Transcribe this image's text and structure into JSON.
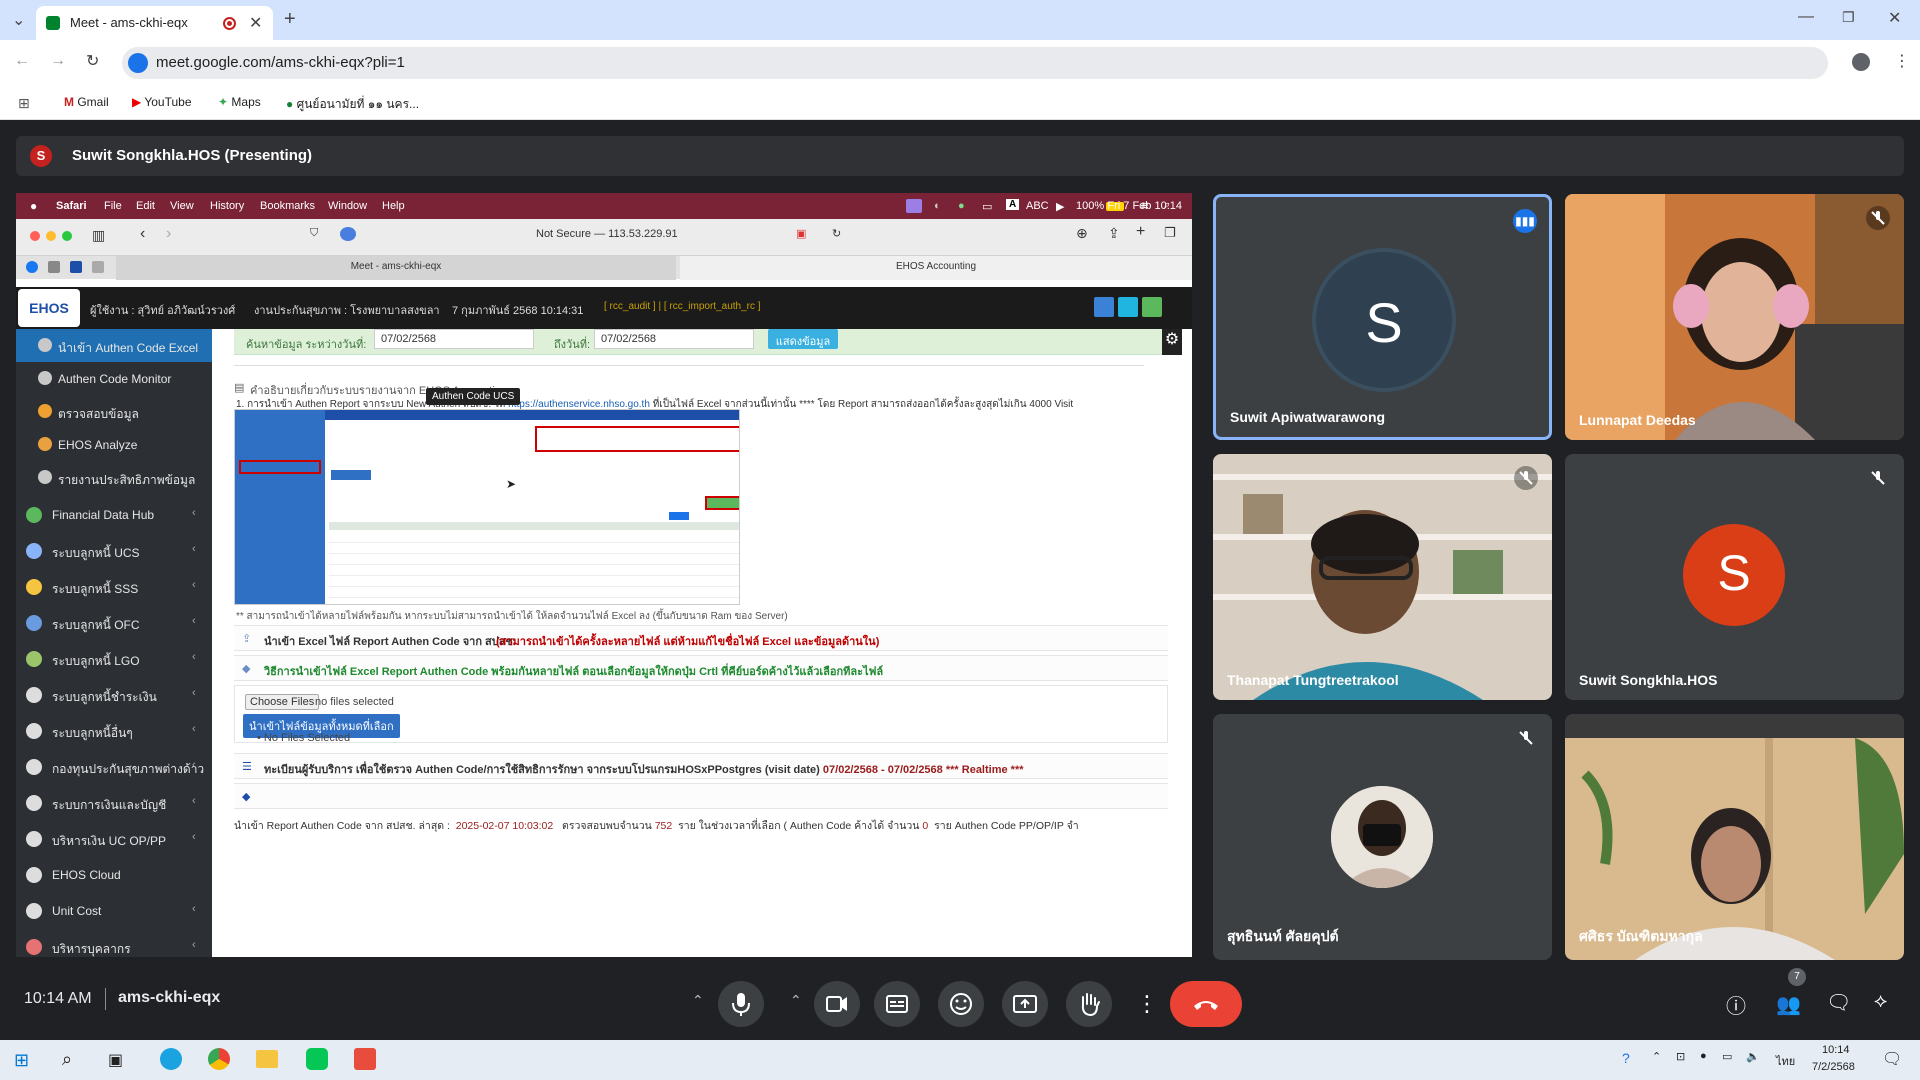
{
  "browser": {
    "tab_title": "Meet - ams-ckhi-eqx",
    "url": "meet.google.com/ams-ckhi-eqx?pli=1",
    "bookmarks": [
      "Gmail",
      "YouTube",
      "Maps",
      "ศูนย์อนามัยที่ ๑๑ นคร..."
    ]
  },
  "meet": {
    "presenter_initial": "S",
    "presenter_label": "Suwit Songkhla.HOS (Presenting)",
    "time": "10:14 AM",
    "meeting_code": "ams-ckhi-eqx",
    "participants_count": "7"
  },
  "tiles": [
    {
      "name": "Suwit Apiwatwarawong",
      "initial": "S"
    },
    {
      "name": "Lunnapat Deedas"
    },
    {
      "name": "Thanapat Tungtreetrakool"
    },
    {
      "name": "Suwit Songkhla.HOS",
      "initial": "S"
    },
    {
      "name": "สุทธินนท์ ศัลยคุปต์"
    },
    {
      "name": "ศศิธร บัณฑิตมหากุล"
    }
  ],
  "mac": {
    "menus": [
      "Safari",
      "File",
      "Edit",
      "View",
      "History",
      "Bookmarks",
      "Window",
      "Help"
    ],
    "battery": "100%",
    "datetime": "Fri 7 Feb 10:14",
    "abc": "ABC"
  },
  "safari": {
    "address": "Not Secure — 113.53.229.91",
    "tab1": "Meet - ams-ckhi-eqx",
    "tab2": "EHOS Accounting"
  },
  "ehos": {
    "logo": "EHOS",
    "header_user": "ผู้ใช้งาน : สุวิทย์ อภิวัฒน์วรวงศ์",
    "header_org": "งานประกันสุขภาพ : โรงพยาบาลสงขลา",
    "header_date": "7 กุมภาพันธ์ 2568 10:14:31",
    "header_tags": "[ rcc_audit ] | [ rcc_import_auth_rc ]",
    "date_from_label": "ค้นหาข้อมูล ระหว่างวันที่:",
    "date_from": "07/02/2568",
    "date_to_label": "ถึงวันที่:",
    "date_to": "07/02/2568",
    "show_btn": "แสดงข้อมูล",
    "sidebar_sub": [
      "นำเข้า Authen Code Excel",
      "Authen Code Monitor",
      "ตรวจสอบข้อมูล",
      "EHOS Analyze",
      "รายงานประสิทธิภาพข้อมูล"
    ],
    "sidebar_main": [
      "Financial Data Hub",
      "ระบบลูกหนี้ UCS",
      "ระบบลูกหนี้ SSS",
      "ระบบลูกหนี้ OFC",
      "ระบบลูกหนี้ LGO",
      "ระบบลูกหนี้ชำระเงิน",
      "ระบบลูกหนี้อื่นๆ",
      "กองทุนประกันสุขภาพต่างด้าว",
      "ระบบการเงินและบัญชี",
      "บริหารเงิน UC OP/PP",
      "EHOS Cloud",
      "Unit Cost",
      "บริหารบุคลากร"
    ],
    "desc_title": "คำอธิบายเกี่ยวกับระบบรายงานจาก EHOS Accounting",
    "tooltip": "Authen Code UCS",
    "step1": "1. การนำเข้า Authen Report จากระบบ New Authen สปสช. ให้",
    "step1_link": "https://authenservice.nhso.go.th",
    "step1_tail": "ที่เป็นไฟล์ Excel จากส่วนนี้เท่านั้น **** โดย Report สามารถส่งออกได้ครั้งละสูงสุดไม่เกิน 4000 Visit",
    "note": "** สามารถนำเข้าได้หลายไฟล์พร้อมกัน หากระบบไม่สามารถนำเข้าได้ ให้ลดจำนวนไฟล์ Excel ลง (ขึ้นกับขนาด Ram ของ Server)",
    "import_label": "นำเข้า Excel ไฟล์ Report Authen Code จาก สปสช.",
    "import_warn": "(สามารถนำเข้าได้ครั้งละหลายไฟล์ แต่ห้ามแก้ไขชื่อไฟล์ Excel และข้อมูลด้านใน)",
    "howto": "วิธีการนำเข้าไฟล์ Excel Report Authen Code พร้อมกันหลายไฟล์ ตอนเลือกข้อมูลให้กดปุ่ม Crtl ที่คีย์บอร์ดค้างไว้แล้วเลือกทีละไฟล์",
    "choose_files": "Choose Files",
    "no_file": "no files selected",
    "upload_btn": "นำเข้าไฟล์ข้อมูลทั้งหมดที่เลือก",
    "no_files_selected": "No Files Selected",
    "registry_label": "ทะเบียนผู้รับบริการ เพื่อใช้ตรวจ Authen Code/การใช้สิทธิการรักษา จากระบบโปรแกรมHOSxPPostgres (visit date)",
    "registry_dates": "07/02/2568 - 07/02/2568",
    "realtime": "*** Realtime ***",
    "bottom_label": "นำเข้า Report Authen Code จาก สปสช. ล่าสุด :",
    "bottom_ts": "2025-02-07 10:03:02",
    "bottom_found": "ตรวจสอบพบจำนวน",
    "bottom_count": "752",
    "bottom_rest": "ราย ในช่วงเวลาที่เลือก ( Authen Code ค้างได้ จำนวน",
    "bottom_zero": "0",
    "bottom_tail": "ราย Authen Code PP/OP/IP จำ"
  },
  "taskbar": {
    "time": "10:14",
    "date": "7/2/2568",
    "lang": "ไทย"
  },
  "colors": {
    "meet_bg": "#202124",
    "tile_bg": "#3c4043",
    "end_call": "#ea4335",
    "ehos_sidebar": "#2c2f34",
    "link": "#1a5fb4",
    "warn": "#c00000",
    "green": "#1e8a2e",
    "active_tile_border": "#8ab4f8"
  }
}
